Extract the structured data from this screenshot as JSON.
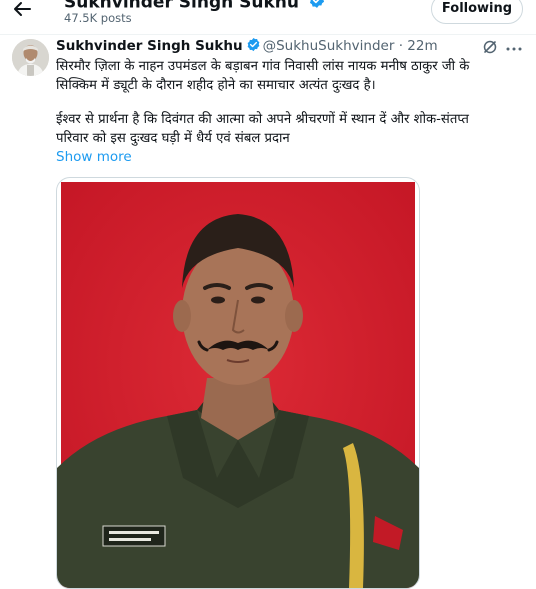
{
  "header": {
    "profile_name": "Sukhvinder Singh Sukhu",
    "post_count": "47.5K posts",
    "follow_label": "Following"
  },
  "tweet": {
    "author_name": "Sukhvinder Singh Sukhu",
    "handle": "@SukhuSukhvinder",
    "separator": "·",
    "time": "22m",
    "paragraph1_line1": "सिरमौर ज़िला के नाहन उपमंडल के बड़ाबन गांव निवासी लांस नायक मनीष ठाकुर जी के",
    "paragraph1_line2": "सिक्किम में ड्यूटी के दौरान शहीद होने का समाचार अत्यंत दुःखद है।",
    "paragraph2_line1": "ईश्वर से प्रार्थना है कि दिवंगत की आत्मा को अपने श्रीचरणों में स्थान दें और शोक-संतप्त",
    "paragraph2_line2": "परिवार को इस दुःखद घड़ी में धैर्य एवं संबल प्रदान",
    "show_more": "Show more"
  },
  "icons": {
    "back": "arrow-left-icon",
    "verified": "verified-badge-icon",
    "grok": "grok-icon",
    "more": "more-dots-icon"
  },
  "colors": {
    "accent": "#1d9bf0",
    "text_primary": "#0f1419",
    "text_secondary": "#536471",
    "photo_background": "#d3202e"
  }
}
